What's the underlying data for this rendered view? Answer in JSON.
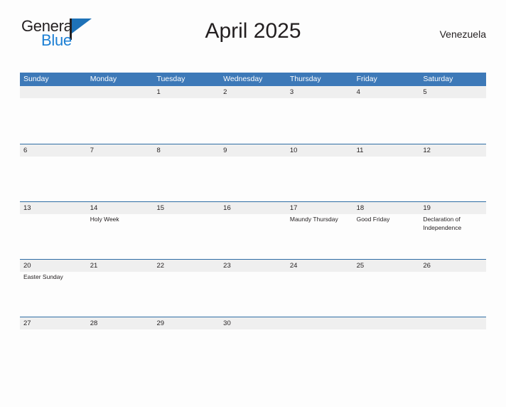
{
  "brand": {
    "name_part1": "General",
    "name_part2": "Blue",
    "flag_icon": "flag-triangle-icon"
  },
  "header": {
    "title": "April 2025",
    "country": "Venezuela"
  },
  "colors": {
    "header_blue": "#3d79b8",
    "rule_blue": "#2e6da4",
    "band_gray": "#efefef",
    "brand_blue": "#1b7fd4",
    "text_dark": "#231f20",
    "page_background": "#fdfdfd"
  },
  "calendar": {
    "weekdays": [
      "Sunday",
      "Monday",
      "Tuesday",
      "Wednesday",
      "Thursday",
      "Friday",
      "Saturday"
    ],
    "weeks": [
      [
        {
          "day": "",
          "events": []
        },
        {
          "day": "",
          "events": []
        },
        {
          "day": "1",
          "events": []
        },
        {
          "day": "2",
          "events": []
        },
        {
          "day": "3",
          "events": []
        },
        {
          "day": "4",
          "events": []
        },
        {
          "day": "5",
          "events": []
        }
      ],
      [
        {
          "day": "6",
          "events": []
        },
        {
          "day": "7",
          "events": []
        },
        {
          "day": "8",
          "events": []
        },
        {
          "day": "9",
          "events": []
        },
        {
          "day": "10",
          "events": []
        },
        {
          "day": "11",
          "events": []
        },
        {
          "day": "12",
          "events": []
        }
      ],
      [
        {
          "day": "13",
          "events": []
        },
        {
          "day": "14",
          "events": [
            "Holy Week"
          ]
        },
        {
          "day": "15",
          "events": []
        },
        {
          "day": "16",
          "events": []
        },
        {
          "day": "17",
          "events": [
            "Maundy Thursday"
          ]
        },
        {
          "day": "18",
          "events": [
            "Good Friday"
          ]
        },
        {
          "day": "19",
          "events": [
            "Declaration of Independence"
          ]
        }
      ],
      [
        {
          "day": "20",
          "events": [
            "Easter Sunday"
          ]
        },
        {
          "day": "21",
          "events": []
        },
        {
          "day": "22",
          "events": []
        },
        {
          "day": "23",
          "events": []
        },
        {
          "day": "24",
          "events": []
        },
        {
          "day": "25",
          "events": []
        },
        {
          "day": "26",
          "events": []
        }
      ],
      [
        {
          "day": "27",
          "events": []
        },
        {
          "day": "28",
          "events": []
        },
        {
          "day": "29",
          "events": []
        },
        {
          "day": "30",
          "events": []
        },
        {
          "day": "",
          "events": []
        },
        {
          "day": "",
          "events": []
        },
        {
          "day": "",
          "events": []
        }
      ]
    ]
  }
}
